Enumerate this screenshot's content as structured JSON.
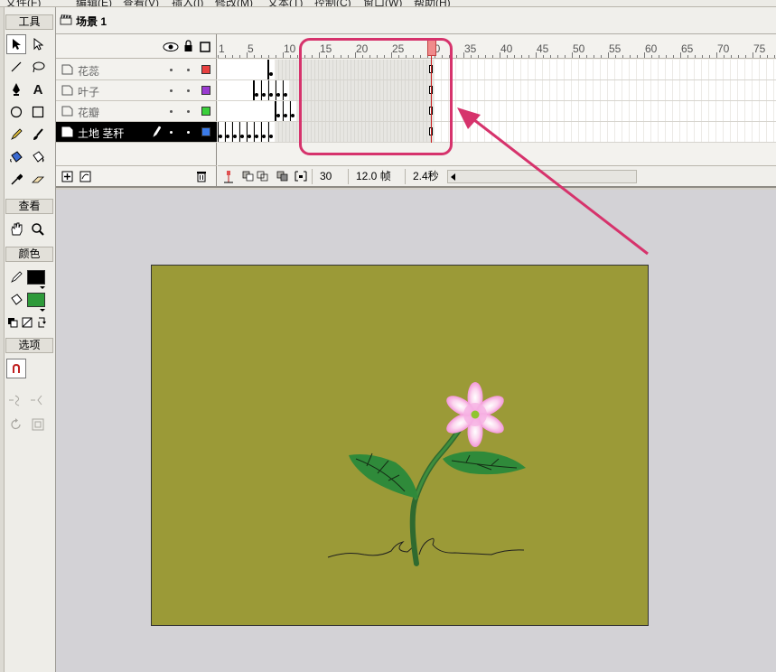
{
  "menu": {
    "items": [
      "文件(F)",
      "编辑(E)",
      "查看(V)",
      "插入(I)",
      "修改(M)",
      "文本(T)",
      "控制(C)",
      "窗口(W)",
      "帮助(H)"
    ]
  },
  "tools": {
    "header_tools": "工具",
    "header_view": "查看",
    "header_colors": "颜色",
    "header_options": "选项",
    "stroke_color": "#000000",
    "fill_color": "#2e9a3a"
  },
  "scene": {
    "label": "场景 1"
  },
  "timeline": {
    "ruler_labels": [
      "1",
      "5",
      "10",
      "15",
      "20",
      "25",
      "30",
      "35",
      "40",
      "45",
      "50",
      "55",
      "60",
      "65",
      "70",
      "75"
    ],
    "layers": [
      {
        "name": "花蕊",
        "color": "#e84040",
        "active": false
      },
      {
        "name": "叶子",
        "color": "#9a3ad0",
        "active": false
      },
      {
        "name": "花瓣",
        "color": "#3ad03a",
        "active": false
      },
      {
        "name": "土地 茎秆",
        "color": "#3a7ae8",
        "active": true
      }
    ],
    "status": {
      "current_frame": "30",
      "frame_rate": "12.0 帧",
      "elapsed": "2.4秒"
    }
  },
  "annotation": {
    "color": "#d6336c"
  },
  "stage": {
    "background": "#9b9a37"
  }
}
